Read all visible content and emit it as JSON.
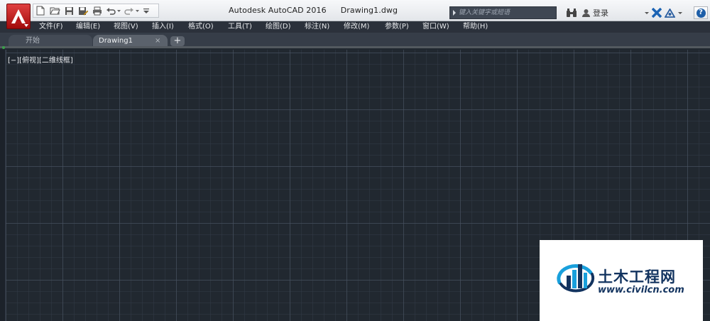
{
  "app": {
    "title": "Autodesk AutoCAD 2016",
    "document": "Drawing1.dwg"
  },
  "search": {
    "placeholder": "键入关键字或短语"
  },
  "account": {
    "login_label": "登录"
  },
  "menu": [
    "文件(F)",
    "编辑(E)",
    "视图(V)",
    "插入(I)",
    "格式(O)",
    "工具(T)",
    "绘图(D)",
    "标注(N)",
    "修改(M)",
    "参数(P)",
    "窗口(W)",
    "帮助(H)"
  ],
  "tabs": {
    "start": "开始",
    "drawing": "Drawing1",
    "close": "×",
    "add": "+"
  },
  "viewport": {
    "label": "[−][俯视][二维线框]"
  },
  "help": {
    "label": "?"
  },
  "watermark": {
    "name": "土木工程网",
    "url": "www.civilcn.com"
  },
  "icons": [
    "acad-app-icon",
    "new-icon",
    "open-icon",
    "save-icon",
    "save-as-icon",
    "print-icon",
    "undo-icon",
    "redo-icon",
    "customize-icon",
    "binoculars-icon",
    "user-icon",
    "exchange-icon",
    "a360-icon",
    "help-icon"
  ],
  "colors": {
    "accent": "#c0161c",
    "canvas": "#212830",
    "menubar": "#2b313b",
    "watermark": "#12335f"
  }
}
